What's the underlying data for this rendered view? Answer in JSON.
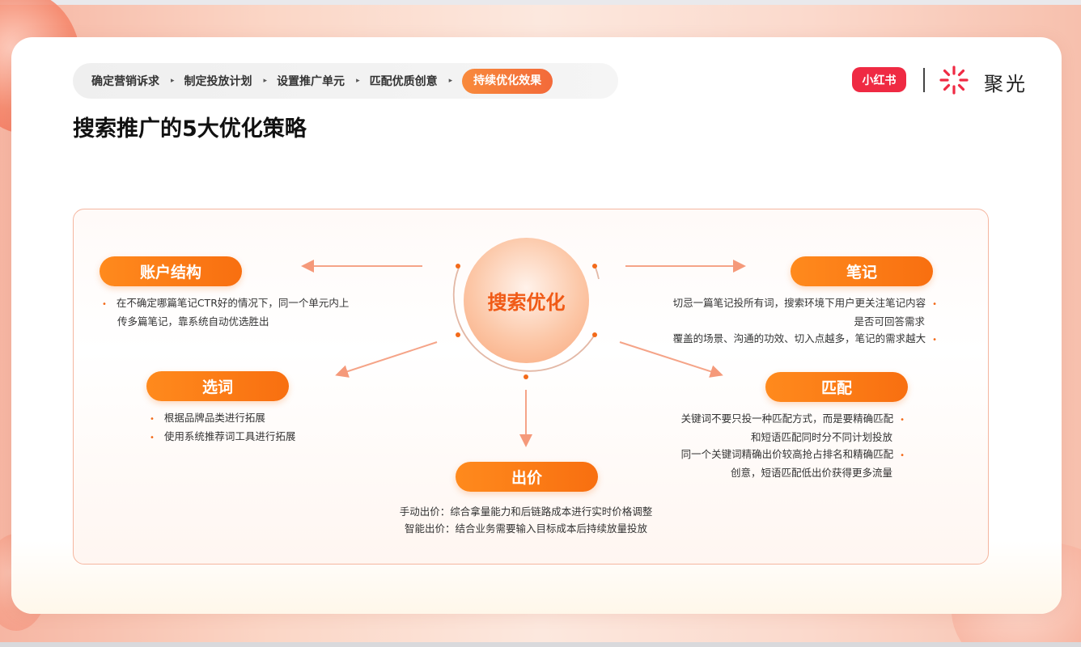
{
  "breadcrumb": {
    "steps": [
      "确定营销诉求",
      "制定投放计划",
      "设置推广单元",
      "匹配优质创意"
    ],
    "active": "持续优化效果",
    "separator": "▸"
  },
  "title": "搜索推广的5大优化策略",
  "brand": {
    "xhs_logo": "小红书",
    "product": "聚光",
    "spark_icon": "spark-icon"
  },
  "center": {
    "label": "搜索优化"
  },
  "nodes": {
    "account": {
      "title": "账户结构",
      "lines": [
        "在不确定哪篇笔记CTR好的情况下，同一个单元内上",
        "传多篇笔记，靠系统自动优选胜出"
      ]
    },
    "note": {
      "title": "笔记",
      "lines": [
        "切忌一篇笔记投所有词，搜索环境下用户更关注笔记内容",
        "是否可回答需求",
        "覆盖的场景、沟通的功效、切入点越多，笔记的需求越大"
      ]
    },
    "keyword": {
      "title": "选词",
      "lines": [
        "根据品牌品类进行拓展",
        "使用系统推荐词工具进行拓展"
      ]
    },
    "match": {
      "title": "匹配",
      "lines": [
        "关键词不要只投一种匹配方式，而是要精确匹配",
        "和短语匹配同时分不同计划投放",
        "同一个关键词精确出价较高抢占排名和精确匹配",
        "创意，短语匹配低出价获得更多流量"
      ]
    },
    "bid": {
      "title": "出价",
      "lines": [
        "手动出价：综合拿量能力和后链路成本进行实时价格调整",
        "智能出价：结合业务需要输入目标成本后持续放量投放"
      ]
    }
  },
  "colors": {
    "accent": "#f86f10",
    "brand_red": "#ef2a43",
    "center_text": "#f05a16"
  }
}
